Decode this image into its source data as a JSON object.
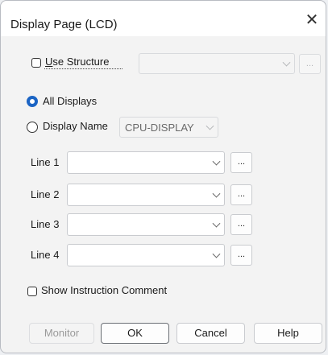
{
  "dialog": {
    "title": "Display Page (LCD)",
    "close_glyph": "✕"
  },
  "use_structure": {
    "label_first": "U",
    "label_rest": "se Structure",
    "checked": false,
    "combo_value": "",
    "dots_label": "..."
  },
  "target": {
    "all_displays_label": "All Displays",
    "display_name_label": "Display Name",
    "display_name_value": "CPU-DISPLAY",
    "selected": "all_displays"
  },
  "lines": [
    {
      "label": "Line 1",
      "value": "",
      "dots_label": "..."
    },
    {
      "label": "Line 2",
      "value": "",
      "dots_label": "..."
    },
    {
      "label": "Line 3",
      "value": "",
      "dots_label": "..."
    },
    {
      "label": "Line 4",
      "value": "",
      "dots_label": "..."
    }
  ],
  "show_comment": {
    "label": "Show Instruction Comment",
    "checked": false
  },
  "buttons": {
    "monitor": "Monitor",
    "ok": "OK",
    "cancel": "Cancel",
    "help": "Help"
  },
  "colors": {
    "accent": "#1b64c4",
    "dialog_bg": "#f3f3f3",
    "titlebar_bg": "#ffffff"
  }
}
